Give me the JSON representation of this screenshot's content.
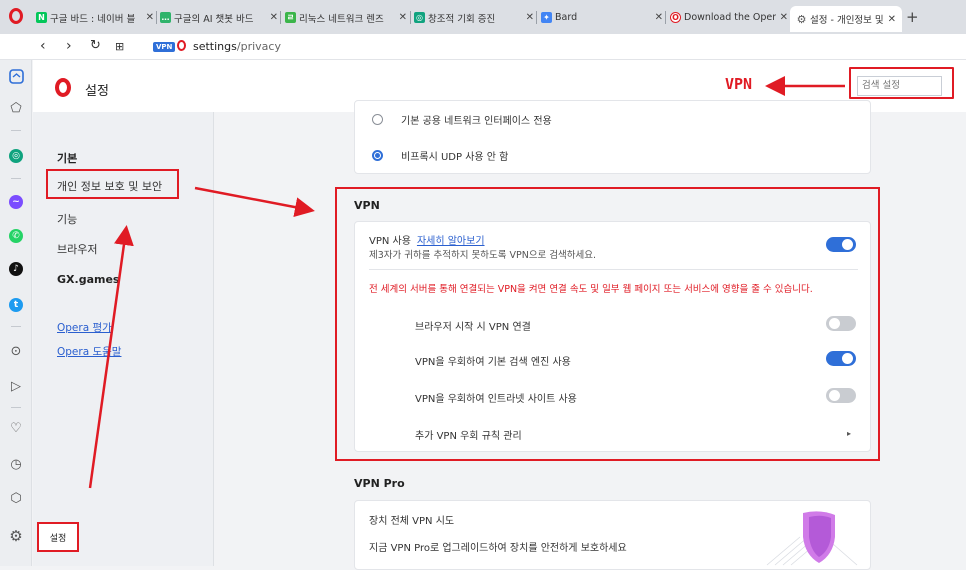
{
  "tabs": [
    {
      "title": "구글 바드 : 네이버 블",
      "color": "#03c75a",
      "glyph": "N"
    },
    {
      "title": "구글의 AI 챗봇 바드",
      "color": "#2fb36b",
      "glyph": "…"
    },
    {
      "title": "리눅스 네트워크 렌즈",
      "color": "#3bb54a",
      "glyph": "ㄹ"
    },
    {
      "title": "창조적 기회 증진",
      "color": "#10a37f",
      "glyph": "◎"
    },
    {
      "title": "Bard",
      "color": "#4285f4",
      "glyph": "✦"
    },
    {
      "title": "Download the Opera",
      "color": "#e01b24",
      "glyph": "O"
    },
    {
      "title": "설정 - 개인정보 및 보안",
      "color": "#555555",
      "glyph": "⚙"
    }
  ],
  "address": {
    "host": "settings",
    "path": "/privacy",
    "vpn_badge": "VPN"
  },
  "header": {
    "title": "설정",
    "search_placeholder": "검색 설정"
  },
  "annotation": {
    "vpn_label": "VPN"
  },
  "nav": {
    "basic": "기본",
    "privacy": "개인 정보 보호 및 보안",
    "features": "기능",
    "browser": "브라우저",
    "gx": "GX.games",
    "rate": "Opera 평가",
    "help": "Opera 도움말"
  },
  "network": {
    "option1": "기본 공용 네트워크 인터페이스 전용",
    "option2": "비프록시 UDP 사용 안 함"
  },
  "vpn": {
    "title": "VPN",
    "enable_label": "VPN 사용",
    "learn_more": "자세히 알아보기",
    "enable_desc": "제3자가 귀하를 추적하지 못하도록 VPN으로 검색하세요.",
    "enabled": true,
    "warning": "전 세계의 서버를 통해 연결되는 VPN을 켜면 연결 속도 및 일부 웹 페이지 또는 서비스에 영향을 줄 수 있습니다.",
    "options": [
      {
        "label": "브라우저 시작 시 VPN 연결",
        "on": false
      },
      {
        "label": "VPN을 우회하여 기본 검색 엔진 사용",
        "on": true
      },
      {
        "label": "VPN을 우회하여 인트라넷 사이트 사용",
        "on": false
      }
    ],
    "bypass_rules": "추가 VPN 우회 규칙 관리"
  },
  "vpn_pro": {
    "title": "VPN Pro",
    "line1": "장치 전체 VPN 시도",
    "line2": "지금 VPN Pro로 업그레이드하여 장치를 안전하게 보호하세요"
  },
  "bottom_setting_label": "설정",
  "colors": {
    "accent": "#2f6fd8",
    "opera_red": "#e01b24",
    "annotation": "#e01b24"
  }
}
